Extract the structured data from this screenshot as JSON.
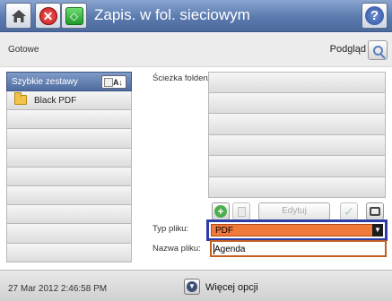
{
  "titlebar": {
    "title": "Zapis. w fol. sieciowym",
    "stop_glyph": "✕",
    "start_glyph": "◇",
    "help_glyph": "?"
  },
  "status": {
    "text": "Gotowe",
    "preview_label": "Podgląd"
  },
  "quick_sets": {
    "title": "Szybkie zestawy",
    "sort_glyph": "A↓",
    "items": [
      {
        "label": "Black PDF",
        "icon": "folder-icon"
      }
    ]
  },
  "folder": {
    "path_label": "Ścieżka folderu"
  },
  "toolbar": {
    "add_glyph": "+",
    "edit_label": "Edytuj",
    "check_glyph": "✓"
  },
  "file_type": {
    "label": "Typ pliku:",
    "value": "PDF",
    "dropdown_glyph": "▼"
  },
  "file_name": {
    "label": "Nazwa pliku:",
    "value": "Agenda"
  },
  "footer": {
    "datetime": "27 Mar 2012 2:46:58 PM",
    "more_options_label": "Więcej opcji",
    "more_glyph": "▼"
  },
  "colors": {
    "title_bar": "#5a79ad",
    "selected_field": "#f07a3c",
    "selection_frame": "#2d3da8",
    "name_field_border": "#c25f22"
  }
}
